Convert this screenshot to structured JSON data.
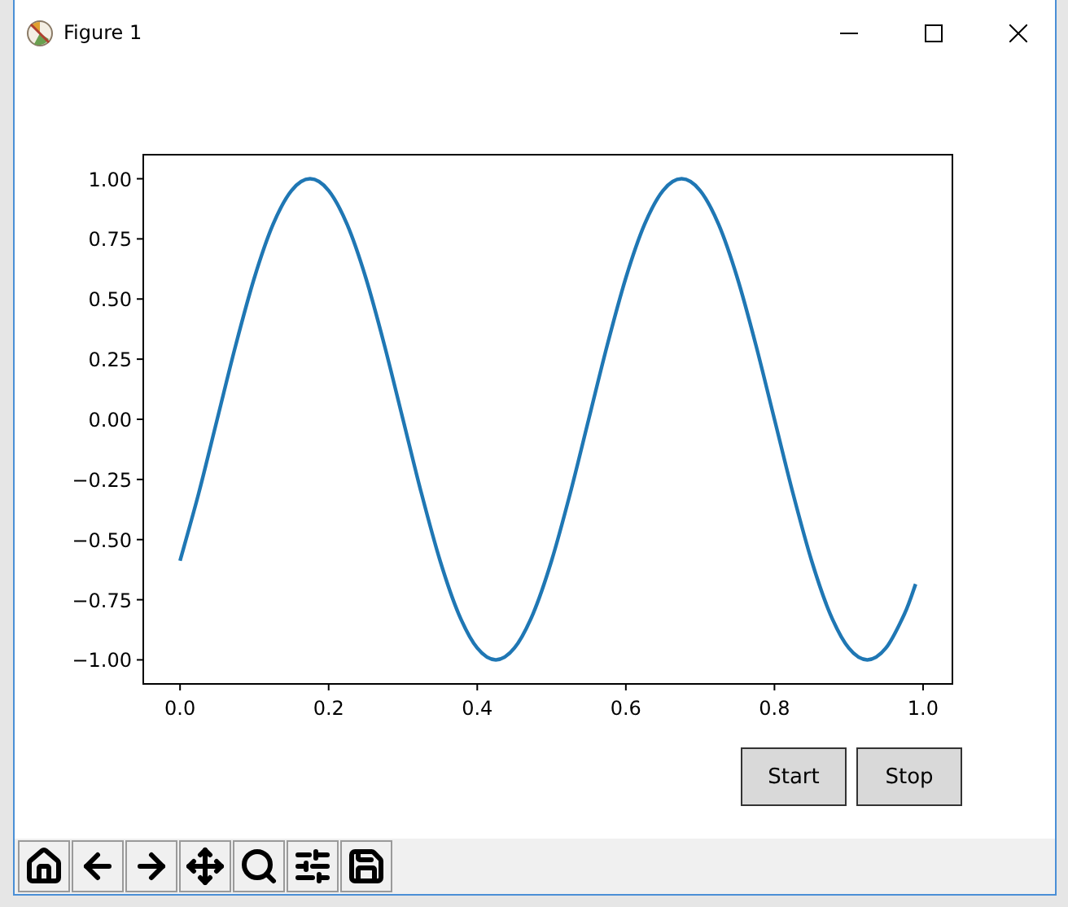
{
  "window": {
    "title": "Figure 1"
  },
  "chart": {
    "chart_data": {
      "type": "line",
      "x": [
        0,
        0.025,
        0.05,
        0.075,
        0.1,
        0.125,
        0.15,
        0.175,
        0.2,
        0.225,
        0.25,
        0.275,
        0.3,
        0.325,
        0.35,
        0.375,
        0.4,
        0.425,
        0.45,
        0.475,
        0.5,
        0.525,
        0.55,
        0.575,
        0.6,
        0.625,
        0.65,
        0.675,
        0.7,
        0.725,
        0.75,
        0.775,
        0.8,
        0.825,
        0.85,
        0.875,
        0.9,
        0.925,
        0.95,
        0.975,
        0.99
      ],
      "series": [
        {
          "color": "#1f77b4",
          "values": [
            -0.588,
            -0.309,
            0,
            0.309,
            0.588,
            0.809,
            0.951,
            1,
            0.951,
            0.809,
            0.588,
            0.309,
            0,
            -0.309,
            -0.588,
            -0.809,
            -0.951,
            -1,
            -0.951,
            -0.809,
            -0.588,
            -0.309,
            0,
            0.309,
            0.588,
            0.809,
            0.951,
            1,
            0.951,
            0.809,
            0.588,
            0.309,
            0,
            -0.309,
            -0.588,
            -0.809,
            -0.951,
            -1,
            -0.951,
            -0.809,
            -0.685
          ]
        }
      ],
      "xlim": [
        -0.0495,
        1.0395
      ],
      "ylim": [
        -1.1,
        1.1
      ],
      "xticks": [
        {
          "value": 0,
          "label": "0.0"
        },
        {
          "value": 0.2,
          "label": "0.2"
        },
        {
          "value": 0.4,
          "label": "0.4"
        },
        {
          "value": 0.6,
          "label": "0.6"
        },
        {
          "value": 0.8,
          "label": "0.8"
        },
        {
          "value": 1,
          "label": "1.0"
        }
      ],
      "yticks": [
        {
          "value": 1,
          "label": "1.00"
        },
        {
          "value": 0.75,
          "label": "0.75"
        },
        {
          "value": 0.5,
          "label": "0.50"
        },
        {
          "value": 0.25,
          "label": "0.25"
        },
        {
          "value": 0,
          "label": "0.00"
        },
        {
          "value": -0.25,
          "label": "−0.25"
        },
        {
          "value": -0.5,
          "label": "−0.50"
        },
        {
          "value": -0.75,
          "label": "−0.75"
        },
        {
          "value": -1,
          "label": "−1.00"
        }
      ]
    }
  },
  "buttons": [
    "Start",
    "Stop"
  ]
}
